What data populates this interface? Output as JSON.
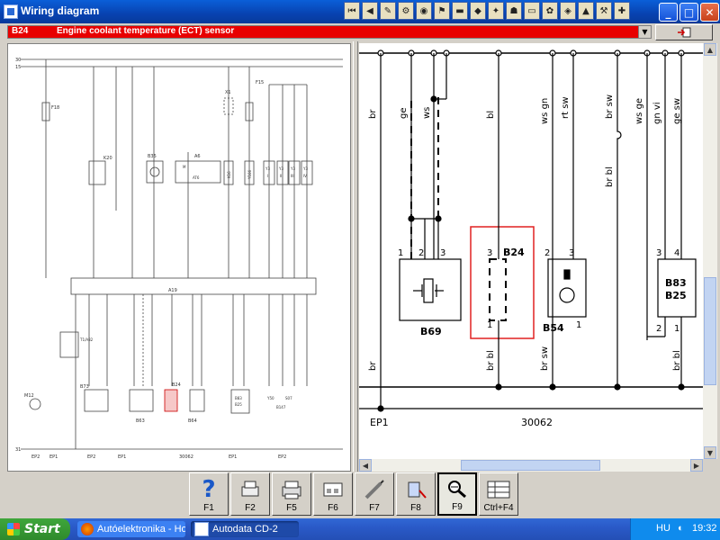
{
  "window": {
    "title": "Wiring diagram"
  },
  "component_select": {
    "code": "B24",
    "name": "Engine coolant temperature (ECT) sensor"
  },
  "overview": {
    "rails": [
      "30",
      "15",
      "31"
    ],
    "components": [
      "F18",
      "K20",
      "B35",
      "A6",
      "X1",
      "F15",
      "M",
      "AT6",
      "K16",
      "Y166",
      "Y3",
      "Y3",
      "Y3",
      "Y3",
      "I",
      "II",
      "III",
      "IV",
      "A19",
      "T1/A82",
      "M12",
      "B73",
      "B63",
      "B24",
      "B64",
      "B83",
      "B25",
      "Y50",
      "B147",
      "S07"
    ],
    "earths": [
      "EP2",
      "EP1",
      "EP2",
      "EP1",
      "30062",
      "EP1",
      "EP2"
    ]
  },
  "detail": {
    "top_wires": [
      "br",
      "ge",
      "ws",
      "bl",
      "ws gn",
      "rt sw",
      "br sw",
      "ws ge",
      "gn vi",
      "ge sw"
    ],
    "jump_wire": "br bl",
    "b69": {
      "name": "B69",
      "pins": [
        "1",
        "2",
        "3"
      ]
    },
    "b24": {
      "name": "B24",
      "pins": [
        "3",
        "1"
      ]
    },
    "b54": {
      "name": "B54",
      "pins": [
        "2",
        "3",
        "1"
      ]
    },
    "b83": {
      "name": "B83",
      "name2": "B25",
      "pins": [
        "3",
        "4",
        "2",
        "1"
      ]
    },
    "bottom_wires": [
      "br",
      "br bl",
      "br sw",
      "br bl"
    ],
    "earth_label": "EP1",
    "ref_number": "30062"
  },
  "fkeys": [
    {
      "label": "F1",
      "icon": "help-icon"
    },
    {
      "label": "F2",
      "icon": "print-icon"
    },
    {
      "label": "F5",
      "icon": "printer-icon"
    },
    {
      "label": "F6",
      "icon": "component-icon"
    },
    {
      "label": "F7",
      "icon": "probe-icon"
    },
    {
      "label": "F8",
      "icon": "meter-icon"
    },
    {
      "label": "F9",
      "icon": "zoom-icon"
    },
    {
      "label": "Ctrl+F4",
      "icon": "table-icon"
    }
  ],
  "taskbar": {
    "start": "Start",
    "tasks": [
      "Autóelektronika - Hob...",
      "Autodata CD-2"
    ],
    "lang": "HU",
    "time": "19:32"
  },
  "colors": {
    "accent": "#e80000",
    "titlebar": "#0842b0",
    "taskbar": "#2a5ac8"
  }
}
